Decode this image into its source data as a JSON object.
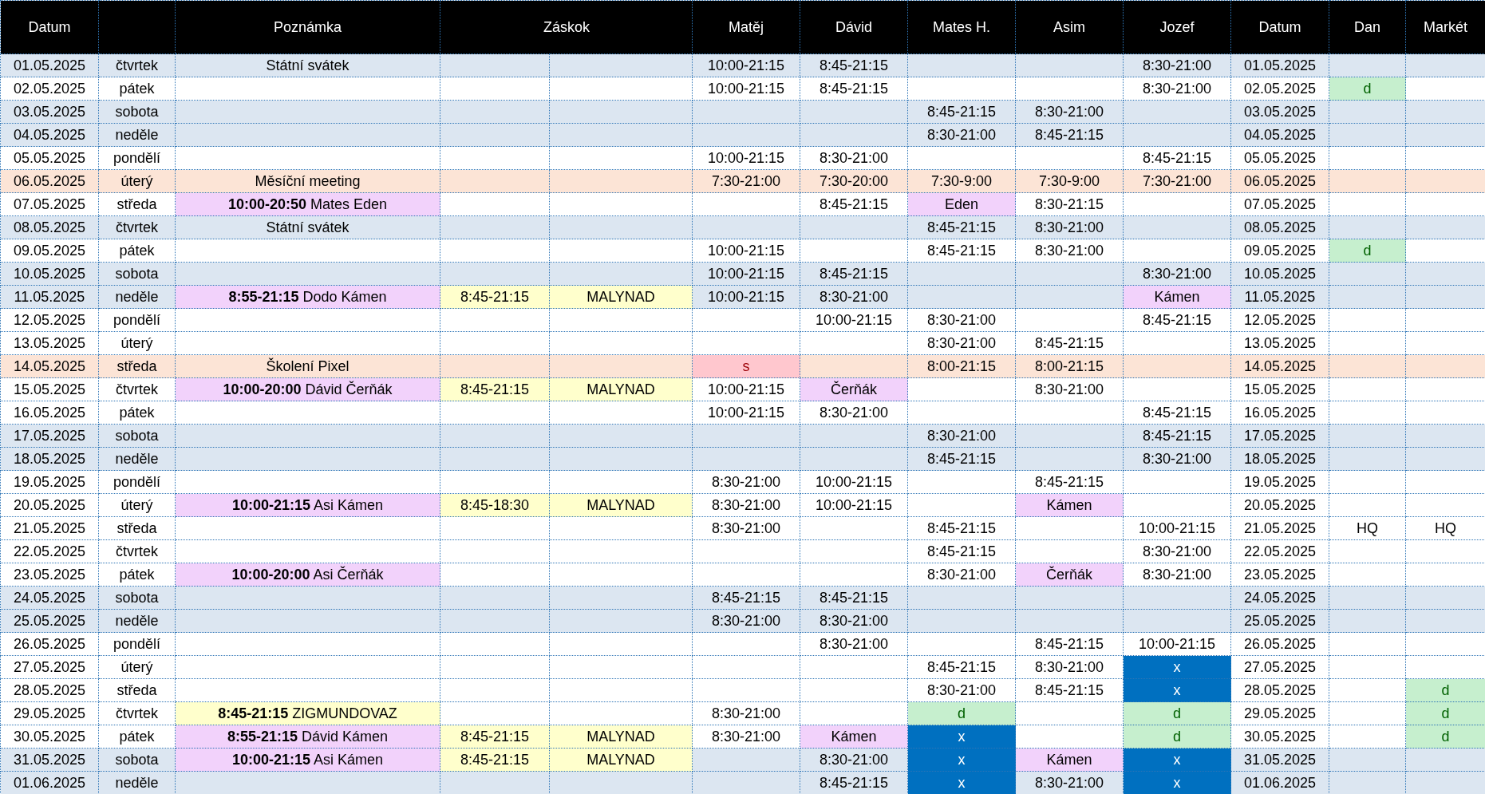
{
  "table": {
    "columns": [
      {
        "label": "Datum"
      },
      {},
      {
        "label": "Poznámka"
      },
      {
        "label": "Záskok",
        "kind": "group"
      },
      {},
      {
        "label": "Matěj"
      },
      {
        "label": "Dávid"
      },
      {
        "label": "Mates H."
      },
      {
        "label": "Asim"
      },
      {
        "label": "Jozef"
      },
      {
        "label": "Datum"
      },
      {
        "label": "Dan"
      },
      {
        "label": "Markét"
      }
    ],
    "rows": [
      {
        "kind": "holiday",
        "cells": [
          {
            "text": "01.05.2025"
          },
          {
            "text": "čtvrtek"
          },
          {
            "text": "Státní svátek"
          },
          {},
          {},
          {
            "text": "10:00-21:15"
          },
          {
            "text": "8:45-21:15"
          },
          {},
          {},
          {
            "text": "8:30-21:00"
          },
          {
            "text": "01.05.2025"
          },
          {},
          {}
        ]
      },
      {
        "kind": "plain",
        "cells": [
          {
            "text": "02.05.2025"
          },
          {
            "text": "pátek"
          },
          {},
          {},
          {},
          {
            "text": "10:00-21:15"
          },
          {
            "text": "8:45-21:15"
          },
          {},
          {},
          {
            "text": "8:30-21:00"
          },
          {
            "text": "02.05.2025"
          },
          {
            "text": "d",
            "color": "#c6efce"
          },
          {}
        ]
      },
      {
        "kind": "weekend",
        "cells": [
          {
            "text": "03.05.2025"
          },
          {
            "text": "sobota"
          },
          {},
          {},
          {},
          {},
          {},
          {
            "text": "8:45-21:15"
          },
          {
            "text": "8:30-21:00"
          },
          {},
          {
            "text": "03.05.2025"
          },
          {},
          {}
        ]
      },
      {
        "kind": "weekend",
        "cells": [
          {
            "text": "04.05.2025"
          },
          {
            "text": "neděle"
          },
          {},
          {},
          {},
          {},
          {},
          {
            "text": "8:30-21:00"
          },
          {
            "text": "8:45-21:15"
          },
          {},
          {
            "text": "04.05.2025"
          },
          {},
          {}
        ]
      },
      {
        "kind": "plain",
        "cells": [
          {
            "text": "05.05.2025"
          },
          {
            "text": "pondělí"
          },
          {},
          {},
          {},
          {
            "text": "10:00-21:15"
          },
          {
            "text": "8:30-21:00"
          },
          {},
          {},
          {
            "text": "8:45-21:15"
          },
          {
            "text": "05.05.2025"
          },
          {},
          {}
        ]
      },
      {
        "kind": "event",
        "cells": [
          {
            "text": "06.05.2025"
          },
          {
            "text": "úterý"
          },
          {
            "text": "Měsíční meeting"
          },
          {},
          {},
          {
            "text": "7:30-21:00"
          },
          {
            "text": "7:30-20:00"
          },
          {
            "text": "7:30-9:00"
          },
          {
            "text": "7:30-9:00"
          },
          {
            "text": "7:30-21:00"
          },
          {
            "text": "06.05.2025"
          },
          {},
          {}
        ]
      },
      {
        "kind": "plain",
        "cells": [
          {
            "text": "07.05.2025"
          },
          {
            "text": "středa"
          },
          {
            "text": "**10:00-20:50** Mates Eden",
            "color": "#f2d2fb"
          },
          {},
          {},
          {},
          {
            "text": "8:45-21:15"
          },
          {
            "text": "Eden",
            "color": "#f2d2fb"
          },
          {
            "text": "8:30-21:15"
          },
          {},
          {
            "text": "07.05.2025"
          },
          {},
          {}
        ]
      },
      {
        "kind": "holiday",
        "cells": [
          {
            "text": "08.05.2025"
          },
          {
            "text": "čtvrtek"
          },
          {
            "text": "Státní svátek"
          },
          {},
          {},
          {},
          {},
          {
            "text": "8:45-21:15"
          },
          {
            "text": "8:30-21:00"
          },
          {},
          {
            "text": "08.05.2025"
          },
          {},
          {}
        ]
      },
      {
        "kind": "plain",
        "cells": [
          {
            "text": "09.05.2025"
          },
          {
            "text": "pátek"
          },
          {},
          {},
          {},
          {
            "text": "10:00-21:15"
          },
          {},
          {
            "text": "8:45-21:15"
          },
          {
            "text": "8:30-21:00"
          },
          {},
          {
            "text": "09.05.2025"
          },
          {
            "text": "d",
            "color": "#c6efce"
          },
          {}
        ]
      },
      {
        "kind": "weekend",
        "cells": [
          {
            "text": "10.05.2025"
          },
          {
            "text": "sobota"
          },
          {},
          {},
          {},
          {
            "text": "10:00-21:15"
          },
          {
            "text": "8:45-21:15"
          },
          {},
          {},
          {
            "text": "8:30-21:00"
          },
          {
            "text": "10.05.2025"
          },
          {},
          {}
        ]
      },
      {
        "kind": "weekend",
        "cells": [
          {
            "text": "11.05.2025"
          },
          {
            "text": "neděle"
          },
          {
            "text": "**8:55-21:15** Dodo Kámen",
            "color": "#f2d2fb"
          },
          {
            "text": "8:45-21:15",
            "color": "#ffffcc"
          },
          {
            "text": "MALYNAD",
            "color": "#ffffcc"
          },
          {
            "text": "10:00-21:15"
          },
          {
            "text": "8:30-21:00"
          },
          {},
          {},
          {
            "text": "Kámen",
            "color": "#f2d2fb"
          },
          {
            "text": "11.05.2025"
          },
          {},
          {}
        ]
      },
      {
        "kind": "plain",
        "cells": [
          {
            "text": "12.05.2025"
          },
          {
            "text": "pondělí"
          },
          {},
          {},
          {},
          {},
          {
            "text": "10:00-21:15"
          },
          {
            "text": "8:30-21:00"
          },
          {},
          {
            "text": "8:45-21:15"
          },
          {
            "text": "12.05.2025"
          },
          {},
          {}
        ]
      },
      {
        "kind": "plain",
        "cells": [
          {
            "text": "13.05.2025"
          },
          {
            "text": "úterý"
          },
          {},
          {},
          {},
          {},
          {},
          {
            "text": "8:30-21:00"
          },
          {
            "text": "8:45-21:15"
          },
          {},
          {
            "text": "13.05.2025"
          },
          {},
          {}
        ]
      },
      {
        "kind": "event",
        "cells": [
          {
            "text": "14.05.2025"
          },
          {
            "text": "středa"
          },
          {
            "text": "Školení Pixel"
          },
          {},
          {},
          {
            "text": "s",
            "color": "#ffc7ce"
          },
          {},
          {
            "text": "8:00-21:15"
          },
          {
            "text": "8:00-21:15"
          },
          {},
          {
            "text": "14.05.2025"
          },
          {},
          {}
        ]
      },
      {
        "kind": "plain",
        "cells": [
          {
            "text": "15.05.2025"
          },
          {
            "text": "čtvrtek"
          },
          {
            "text": "**10:00-20:00** Dávid Čerňák",
            "color": "#f2d2fb"
          },
          {
            "text": "8:45-21:15",
            "color": "#ffffcc"
          },
          {
            "text": "MALYNAD",
            "color": "#ffffcc"
          },
          {
            "text": "10:00-21:15"
          },
          {
            "text": "Čerňák",
            "color": "#f2d2fb"
          },
          {},
          {
            "text": "8:30-21:00"
          },
          {},
          {
            "text": "15.05.2025"
          },
          {},
          {}
        ]
      },
      {
        "kind": "plain",
        "cells": [
          {
            "text": "16.05.2025"
          },
          {
            "text": "pátek"
          },
          {},
          {},
          {},
          {
            "text": "10:00-21:15"
          },
          {
            "text": "8:30-21:00"
          },
          {},
          {},
          {
            "text": "8:45-21:15"
          },
          {
            "text": "16.05.2025"
          },
          {},
          {}
        ]
      },
      {
        "kind": "weekend",
        "cells": [
          {
            "text": "17.05.2025"
          },
          {
            "text": "sobota"
          },
          {},
          {},
          {},
          {},
          {},
          {
            "text": "8:30-21:00"
          },
          {},
          {
            "text": "8:45-21:15"
          },
          {
            "text": "17.05.2025"
          },
          {},
          {}
        ]
      },
      {
        "kind": "weekend",
        "cells": [
          {
            "text": "18.05.2025"
          },
          {
            "text": "neděle"
          },
          {},
          {},
          {},
          {},
          {},
          {
            "text": "8:45-21:15"
          },
          {},
          {
            "text": "8:30-21:00"
          },
          {
            "text": "18.05.2025"
          },
          {},
          {}
        ]
      },
      {
        "kind": "plain",
        "cells": [
          {
            "text": "19.05.2025"
          },
          {
            "text": "pondělí"
          },
          {},
          {},
          {},
          {
            "text": "8:30-21:00"
          },
          {
            "text": "10:00-21:15"
          },
          {},
          {
            "text": "8:45-21:15"
          },
          {},
          {
            "text": "19.05.2025"
          },
          {},
          {}
        ]
      },
      {
        "kind": "plain",
        "cells": [
          {
            "text": "20.05.2025"
          },
          {
            "text": "úterý"
          },
          {
            "text": "**10:00-21:15** Asi Kámen",
            "color": "#f2d2fb"
          },
          {
            "text": "8:45-18:30",
            "color": "#ffffcc"
          },
          {
            "text": "MALYNAD",
            "color": "#ffffcc"
          },
          {
            "text": "8:30-21:00"
          },
          {
            "text": "10:00-21:15"
          },
          {},
          {
            "text": "Kámen",
            "color": "#f2d2fb"
          },
          {},
          {
            "text": "20.05.2025"
          },
          {},
          {}
        ]
      },
      {
        "kind": "plain",
        "cells": [
          {
            "text": "21.05.2025"
          },
          {
            "text": "středa"
          },
          {},
          {},
          {},
          {
            "text": "8:30-21:00"
          },
          {},
          {
            "text": "8:45-21:15"
          },
          {},
          {
            "text": "10:00-21:15"
          },
          {
            "text": "21.05.2025"
          },
          {
            "text": "HQ"
          },
          {
            "text": "HQ"
          }
        ]
      },
      {
        "kind": "plain",
        "cells": [
          {
            "text": "22.05.2025"
          },
          {
            "text": "čtvrtek"
          },
          {},
          {},
          {},
          {},
          {},
          {
            "text": "8:45-21:15"
          },
          {},
          {
            "text": "8:30-21:00"
          },
          {
            "text": "22.05.2025"
          },
          {},
          {}
        ]
      },
      {
        "kind": "plain",
        "cells": [
          {
            "text": "23.05.2025"
          },
          {
            "text": "pátek"
          },
          {
            "text": "**10:00-20:00** Asi Čerňák",
            "color": "#f2d2fb"
          },
          {},
          {},
          {},
          {},
          {
            "text": "8:30-21:00"
          },
          {
            "text": "Čerňák",
            "color": "#f2d2fb"
          },
          {
            "text": "8:30-21:00"
          },
          {
            "text": "23.05.2025"
          },
          {},
          {}
        ]
      },
      {
        "kind": "weekend",
        "cells": [
          {
            "text": "24.05.2025"
          },
          {
            "text": "sobota"
          },
          {},
          {},
          {},
          {
            "text": "8:45-21:15"
          },
          {
            "text": "8:45-21:15"
          },
          {},
          {},
          {},
          {
            "text": "24.05.2025"
          },
          {},
          {}
        ]
      },
      {
        "kind": "weekend",
        "cells": [
          {
            "text": "25.05.2025"
          },
          {
            "text": "neděle"
          },
          {},
          {},
          {},
          {
            "text": "8:30-21:00"
          },
          {
            "text": "8:30-21:00"
          },
          {},
          {},
          {},
          {
            "text": "25.05.2025"
          },
          {},
          {}
        ]
      },
      {
        "kind": "plain",
        "cells": [
          {
            "text": "26.05.2025"
          },
          {
            "text": "pondělí"
          },
          {},
          {},
          {},
          {},
          {
            "text": "8:30-21:00"
          },
          {},
          {
            "text": "8:45-21:15"
          },
          {
            "text": "10:00-21:15"
          },
          {
            "text": "26.05.2025"
          },
          {},
          {}
        ]
      },
      {
        "kind": "plain",
        "cells": [
          {
            "text": "27.05.2025"
          },
          {
            "text": "úterý"
          },
          {},
          {},
          {},
          {},
          {},
          {
            "text": "8:45-21:15"
          },
          {
            "text": "8:30-21:00"
          },
          {
            "text": "x",
            "color": "#0070c0"
          },
          {
            "text": "27.05.2025"
          },
          {},
          {}
        ]
      },
      {
        "kind": "plain",
        "cells": [
          {
            "text": "28.05.2025"
          },
          {
            "text": "středa"
          },
          {},
          {},
          {},
          {},
          {},
          {
            "text": "8:30-21:00"
          },
          {
            "text": "8:45-21:15"
          },
          {
            "text": "x",
            "color": "#0070c0"
          },
          {
            "text": "28.05.2025"
          },
          {},
          {
            "text": "d",
            "color": "#c6efce"
          }
        ]
      },
      {
        "kind": "plain",
        "cells": [
          {
            "text": "29.05.2025"
          },
          {
            "text": "čtvrtek"
          },
          {
            "text": "**8:45-21:15** ZIGMUNDOVAZ",
            "color": "#ffffcc"
          },
          {},
          {},
          {
            "text": "8:30-21:00"
          },
          {},
          {
            "text": "d",
            "color": "#c6efce"
          },
          {},
          {
            "text": "d",
            "color": "#c6efce"
          },
          {
            "text": "29.05.2025"
          },
          {},
          {
            "text": "d",
            "color": "#c6efce"
          }
        ]
      },
      {
        "kind": "plain",
        "cells": [
          {
            "text": "30.05.2025"
          },
          {
            "text": "pátek"
          },
          {
            "text": "**8:55-21:15** Dávid Kámen",
            "color": "#f2d2fb"
          },
          {
            "text": "8:45-21:15",
            "color": "#ffffcc"
          },
          {
            "text": "MALYNAD",
            "color": "#ffffcc"
          },
          {
            "text": "8:30-21:00"
          },
          {
            "text": "Kámen",
            "color": "#f2d2fb"
          },
          {
            "text": "x",
            "color": "#0070c0"
          },
          {},
          {
            "text": "d",
            "color": "#c6efce"
          },
          {
            "text": "30.05.2025"
          },
          {},
          {
            "text": "d",
            "color": "#c6efce"
          }
        ]
      },
      {
        "kind": "weekend",
        "cells": [
          {
            "text": "31.05.2025"
          },
          {
            "text": "sobota"
          },
          {
            "text": "**10:00-21:15** Asi Kámen",
            "color": "#f2d2fb"
          },
          {
            "text": "8:45-21:15",
            "color": "#ffffcc"
          },
          {
            "text": "MALYNAD",
            "color": "#ffffcc"
          },
          {},
          {
            "text": "8:30-21:00"
          },
          {
            "text": "x",
            "color": "#0070c0"
          },
          {
            "text": "Kámen",
            "color": "#f2d2fb"
          },
          {
            "text": "x",
            "color": "#0070c0"
          },
          {
            "text": "31.05.2025"
          },
          {},
          {}
        ]
      },
      {
        "kind": "weekend",
        "cells": [
          {
            "text": "01.06.2025"
          },
          {
            "text": "neděle"
          },
          {},
          {},
          {},
          {},
          {
            "text": "8:45-21:15"
          },
          {
            "text": "x",
            "color": "#0070c0"
          },
          {
            "text": "8:30-21:00"
          },
          {
            "text": "x",
            "color": "#0070c0"
          },
          {
            "text": "01.06.2025"
          },
          {},
          {}
        ]
      }
    ]
  }
}
